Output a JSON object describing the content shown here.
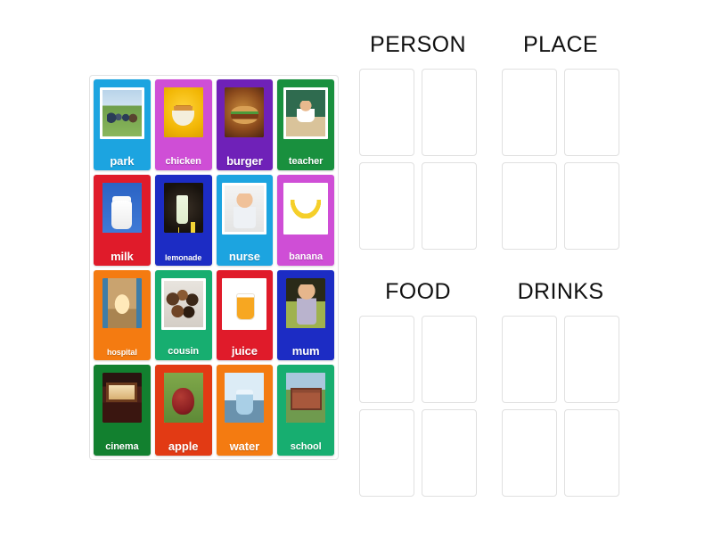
{
  "activity": {
    "type": "group-sort",
    "tray_label": "word-card-tray"
  },
  "cards": [
    {
      "label": "park",
      "bg": "#1CA4E0",
      "art": "art-park",
      "framed": true,
      "size": "normal"
    },
    {
      "label": "chicken",
      "bg": "#CF4ED6",
      "art": "art-chicken",
      "framed": false,
      "size": "small"
    },
    {
      "label": "burger",
      "bg": "#6F21B8",
      "art": "art-burger",
      "framed": false,
      "size": "normal"
    },
    {
      "label": "teacher",
      "bg": "#19903E",
      "art": "art-teacher",
      "framed": true,
      "size": "small"
    },
    {
      "label": "milk",
      "bg": "#E01B2A",
      "art": "art-milk",
      "framed": false,
      "size": "normal"
    },
    {
      "label": "lemonade",
      "bg": "#1C2CC4",
      "art": "art-lemonade",
      "framed": false,
      "size": "xsmall"
    },
    {
      "label": "nurse",
      "bg": "#1CA4E0",
      "art": "art-nurse",
      "framed": true,
      "size": "normal"
    },
    {
      "label": "banana",
      "bg": "#CF4ED6",
      "art": "art-banana",
      "framed": true,
      "size": "small"
    },
    {
      "label": "hospital",
      "bg": "#F47B11",
      "art": "art-hospital",
      "framed": false,
      "size": "xsmall"
    },
    {
      "label": "cousin",
      "bg": "#17AE70",
      "art": "art-cousin",
      "framed": true,
      "size": "small"
    },
    {
      "label": "juice",
      "bg": "#E01B2A",
      "art": "art-juice",
      "framed": true,
      "size": "normal"
    },
    {
      "label": "mum",
      "bg": "#1C2CC4",
      "art": "art-mum",
      "framed": false,
      "size": "normal"
    },
    {
      "label": "cinema",
      "bg": "#12802F",
      "art": "art-cinema",
      "framed": false,
      "size": "small"
    },
    {
      "label": "apple",
      "bg": "#E23A14",
      "art": "art-apple",
      "framed": false,
      "size": "normal"
    },
    {
      "label": "water",
      "bg": "#F47B11",
      "art": "art-water",
      "framed": false,
      "size": "normal"
    },
    {
      "label": "school",
      "bg": "#17AE70",
      "art": "art-school",
      "framed": false,
      "size": "small"
    }
  ],
  "categories": [
    {
      "id": "person",
      "title": "PERSON",
      "slots": 4
    },
    {
      "id": "place",
      "title": "PLACE",
      "slots": 4
    },
    {
      "id": "food",
      "title": "FOOD",
      "slots": 4
    },
    {
      "id": "drinks",
      "title": "DRINKS",
      "slots": 4
    }
  ],
  "colors": {
    "page_background": "#FFFFFF",
    "slot_border": "#E0E0E0",
    "tray_border": "#E2E2E2",
    "title_text": "#111111",
    "card_label_text": "#FFFFFF"
  }
}
